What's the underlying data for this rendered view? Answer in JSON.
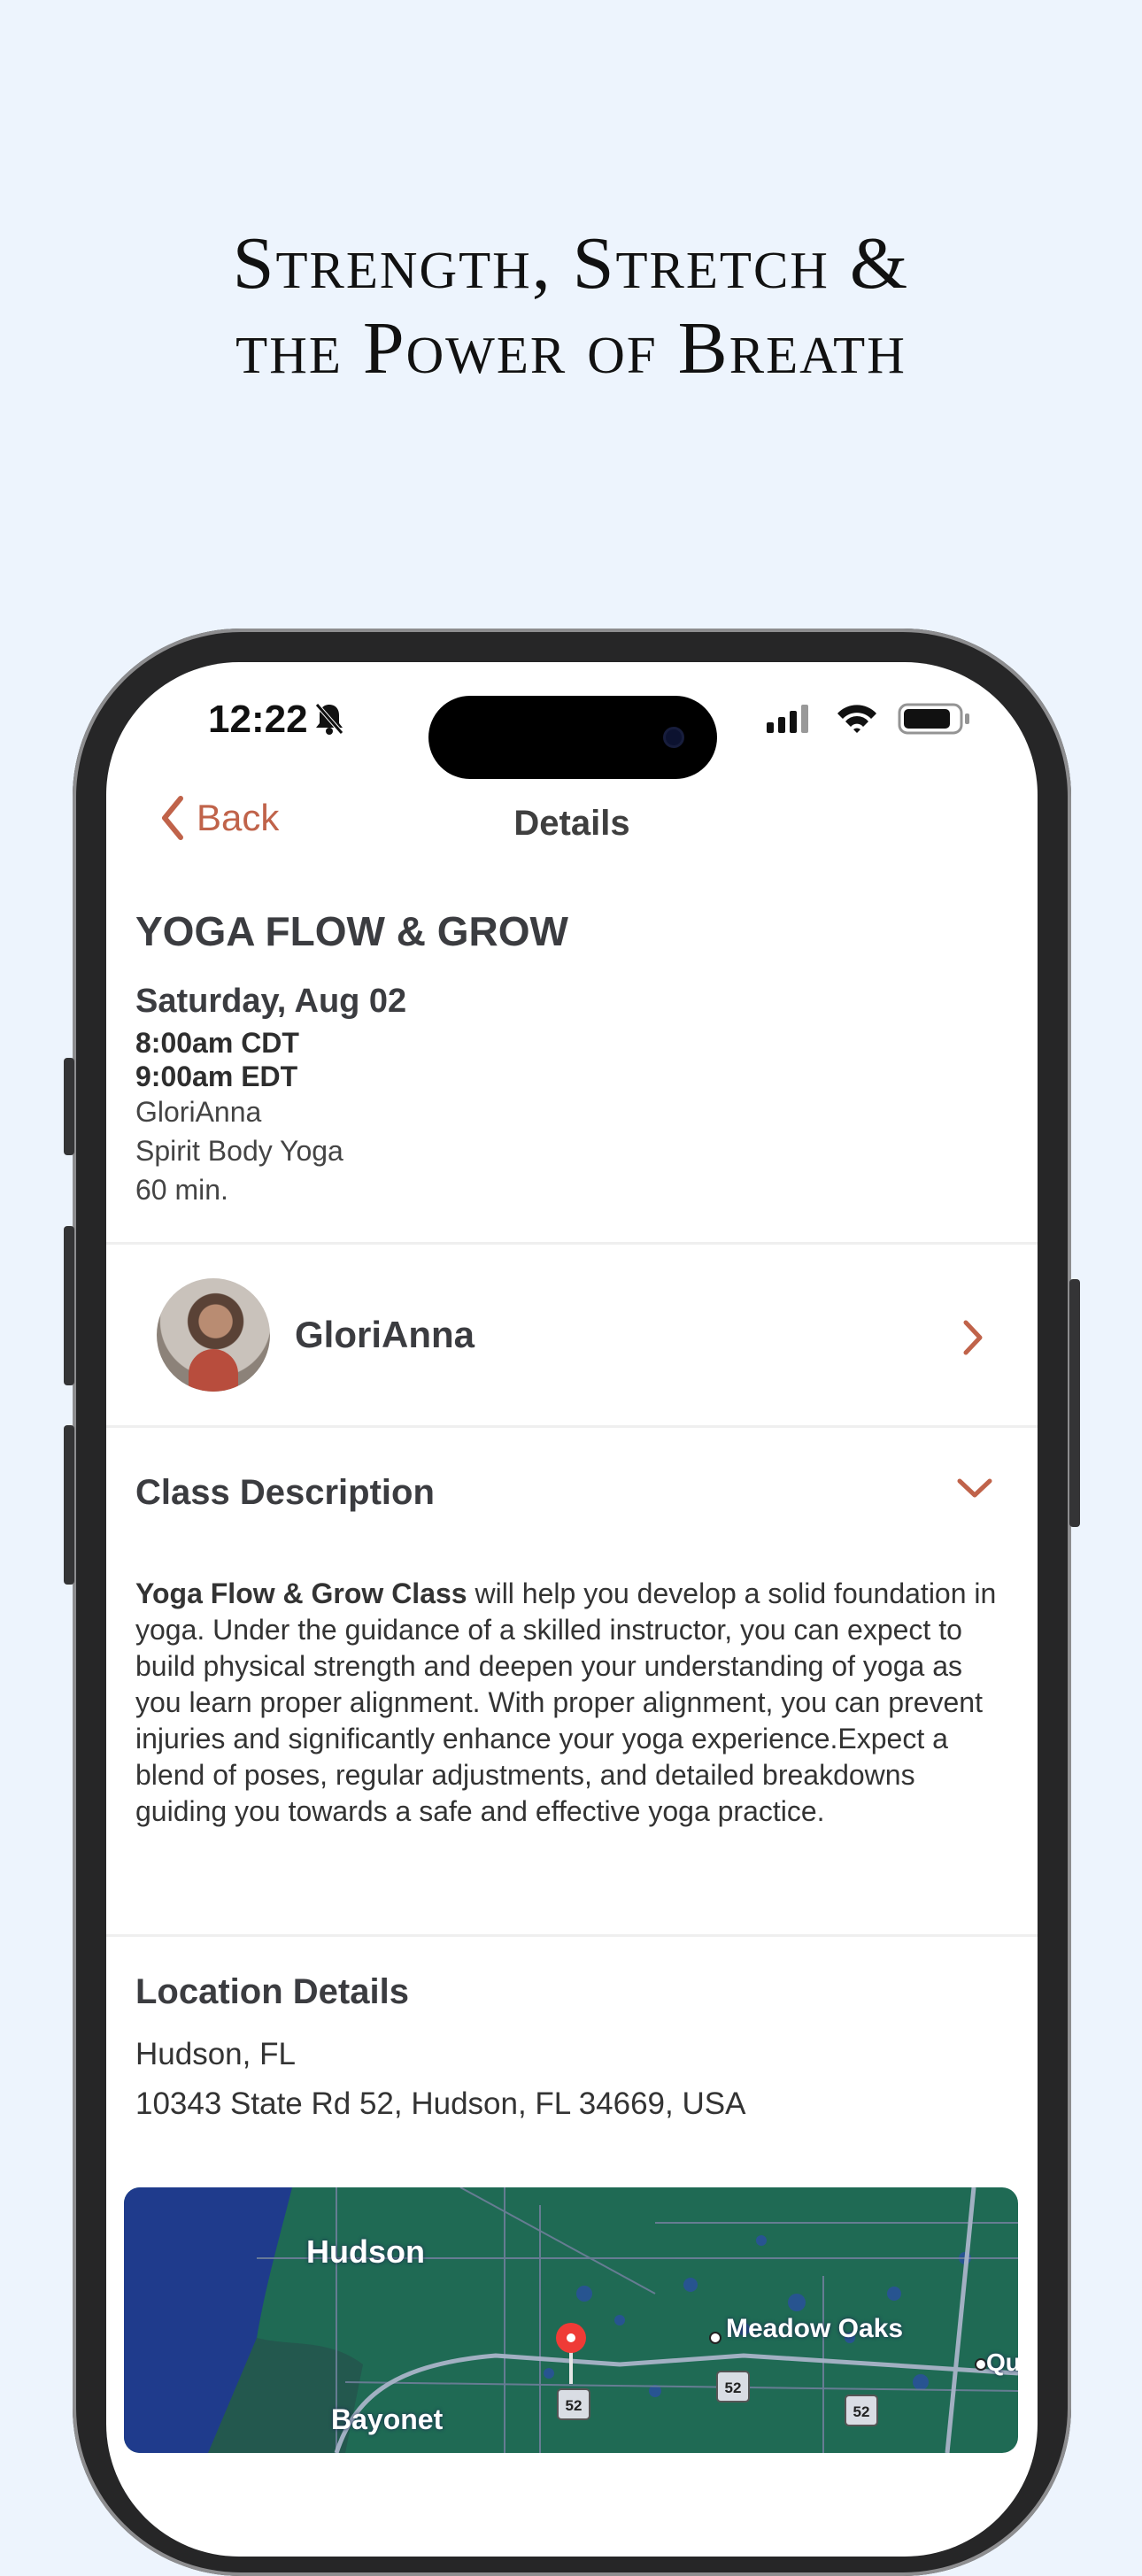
{
  "headline": {
    "line1": "Strength, Stretch &",
    "line2": "the Power of Breath"
  },
  "status_bar": {
    "time": "12:22",
    "icons": [
      "bell-slash-icon",
      "cellular-signal-icon",
      "wifi-icon",
      "battery-icon"
    ]
  },
  "nav": {
    "back_label": "Back",
    "title": "Details"
  },
  "class_info": {
    "title": "YOGA FLOW & GROW",
    "date": "Saturday, Aug 02",
    "time_cdt": "8:00am CDT",
    "time_edt": "9:00am EDT",
    "instructor": "GloriAnna",
    "studio": "Spirit Body Yoga",
    "duration": "60 min."
  },
  "instructor_row": {
    "name": "GloriAnna"
  },
  "description": {
    "heading": "Class Description",
    "lead": "Yoga Flow & Grow Class",
    "body": " will help you develop a solid foundation in yoga. Under the guidance of a skilled instructor, you can expect to build physical strength and deepen your understanding of yoga as you learn proper alignment. With proper alignment, you can prevent injuries and significantly enhance your yoga experience.Expect a blend of poses, regular adjustments, and detailed breakdowns guiding you towards a safe and effective yoga practice."
  },
  "location": {
    "heading": "Location Details",
    "city": "Hudson, FL",
    "address": "10343 State Rd 52, Hudson, FL 34669, USA"
  },
  "map": {
    "labels": [
      "Hudson",
      "Meadow Oaks",
      "Bayonet",
      "Qu"
    ],
    "route_shields": [
      "52",
      "52",
      "52"
    ]
  },
  "colors": {
    "accent": "#c0634a",
    "background": "#edf4fd",
    "map_water": "#1f3b8c",
    "map_land": "#1f6a54"
  }
}
